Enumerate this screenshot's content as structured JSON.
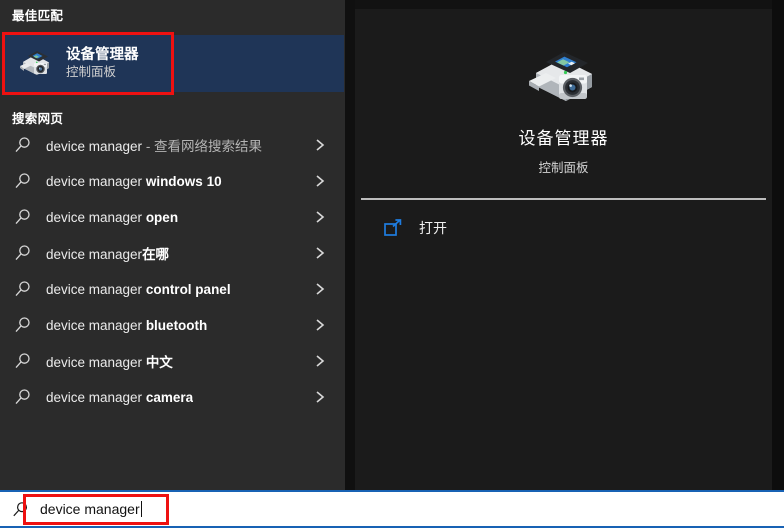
{
  "left": {
    "best_match_header": "最佳匹配",
    "web_search_header": "搜索网页",
    "best_match": {
      "title": "设备管理器",
      "subtitle": "控制面板",
      "icon": "device-manager-icon"
    },
    "suggestions": [
      {
        "prefix": "device manager",
        "bold": "",
        "dim": " - 查看网络搜索结果"
      },
      {
        "prefix": "device manager ",
        "bold": "windows 10",
        "dim": ""
      },
      {
        "prefix": "device manager ",
        "bold": "open",
        "dim": ""
      },
      {
        "prefix": "device manager",
        "bold": "在哪",
        "dim": ""
      },
      {
        "prefix": "device manager ",
        "bold": "control panel",
        "dim": ""
      },
      {
        "prefix": "device manager ",
        "bold": "bluetooth",
        "dim": ""
      },
      {
        "prefix": "device manager ",
        "bold": "中文",
        "dim": ""
      },
      {
        "prefix": "device manager ",
        "bold": "camera",
        "dim": ""
      }
    ]
  },
  "preview": {
    "title": "设备管理器",
    "subtitle": "控制面板",
    "icon": "device-manager-icon",
    "actions": [
      {
        "label": "打开",
        "icon": "open-external-icon"
      }
    ]
  },
  "searchbox": {
    "value": "device manager",
    "icon": "search-icon"
  },
  "colors": {
    "highlight_blue": "#1f3557",
    "annotation_red": "#ee1111",
    "searchbar_border": "#1862b4",
    "accent_blue": "#1e7ce0",
    "panel_left_bg": "#2b2b2b",
    "panel_right_bg": "#1b1b1b"
  }
}
